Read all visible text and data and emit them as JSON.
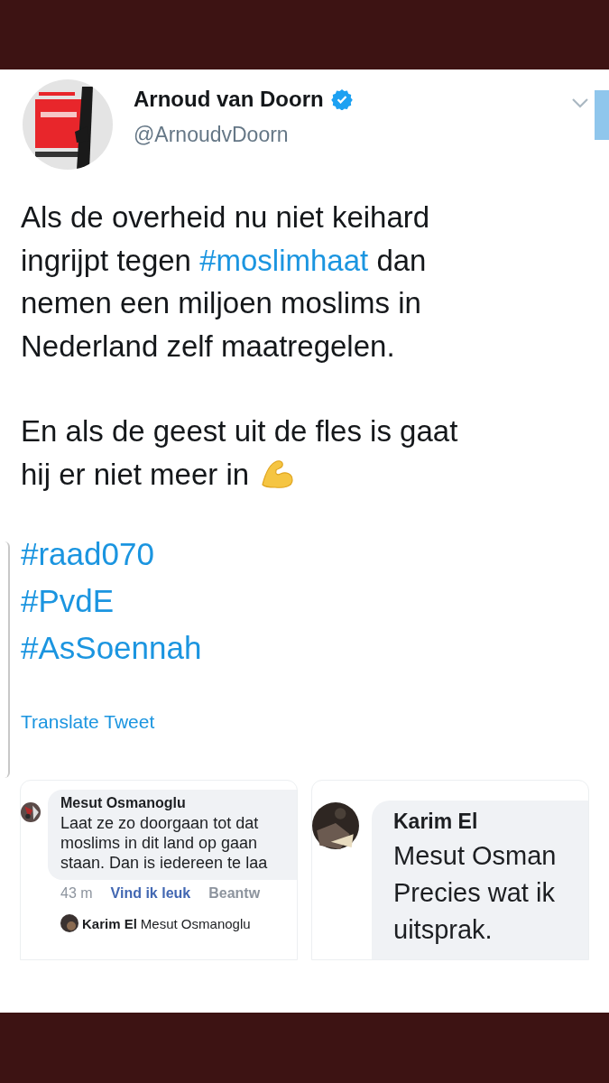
{
  "tweet": {
    "author": {
      "name": "Arnoud van Doorn",
      "verified": true,
      "handle": "@ArnoudvDoorn"
    },
    "paragraphs": [
      [
        [
          {
            "kind": "text",
            "text": "Als de overheid nu niet keihard"
          }
        ],
        [
          {
            "kind": "text",
            "text": "ingrijpt tegen "
          },
          {
            "kind": "hashtag",
            "text": "#moslimhaat"
          },
          {
            "kind": "text",
            "text": " dan"
          }
        ],
        [
          {
            "kind": "text",
            "text": "nemen een miljoen moslims in"
          }
        ],
        [
          {
            "kind": "text",
            "text": "Nederland zelf maatregelen."
          }
        ]
      ],
      [
        [
          {
            "kind": "text",
            "text": "En als de geest uit de fles is gaat"
          }
        ],
        [
          {
            "kind": "text",
            "text": "hij er niet meer in "
          },
          {
            "kind": "emoji"
          }
        ]
      ]
    ],
    "hashtags": [
      "#raad070",
      "#PvdE",
      "#AsSoennah"
    ],
    "translate_link": "Translate Tweet",
    "attached_screenshots": [
      {
        "kind": "comment",
        "author": "Mesut Osmanoglu",
        "lines": [
          "Laat ze zo doorgaan tot dat",
          "moslims in dit land op gaan",
          "staan. Dan is iedereen te laa"
        ],
        "time": "43 m",
        "actions": [
          {
            "label": "Vind ik leuk",
            "highlighted": true
          },
          {
            "label": "Beantw",
            "highlighted": false
          }
        ],
        "reply_author": "Karim El",
        "reply_text": "Mesut Osmanoglu"
      },
      {
        "kind": "reply",
        "author": "Karim El",
        "lines": [
          "Mesut Osman",
          "Precies wat ik",
          "uitsprak."
        ]
      }
    ]
  }
}
